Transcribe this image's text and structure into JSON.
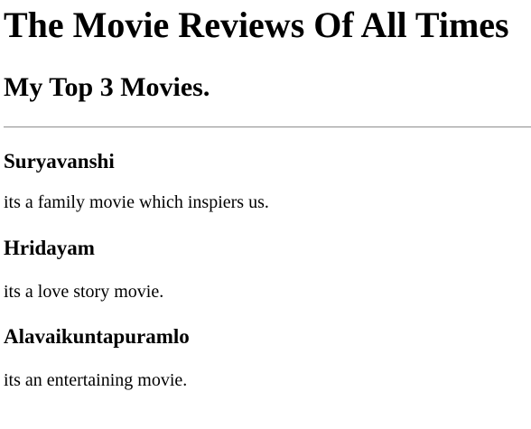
{
  "page": {
    "title": "The Movie Reviews Of All Times",
    "subtitle": "My Top 3 Movies."
  },
  "movies": [
    {
      "name": "Suryavanshi",
      "review": "its a family movie which inspiers us."
    },
    {
      "name": "Hridayam",
      "review": "its a love story movie."
    },
    {
      "name": "Alavaikuntapuramlo",
      "review": "its an entertaining movie."
    }
  ]
}
